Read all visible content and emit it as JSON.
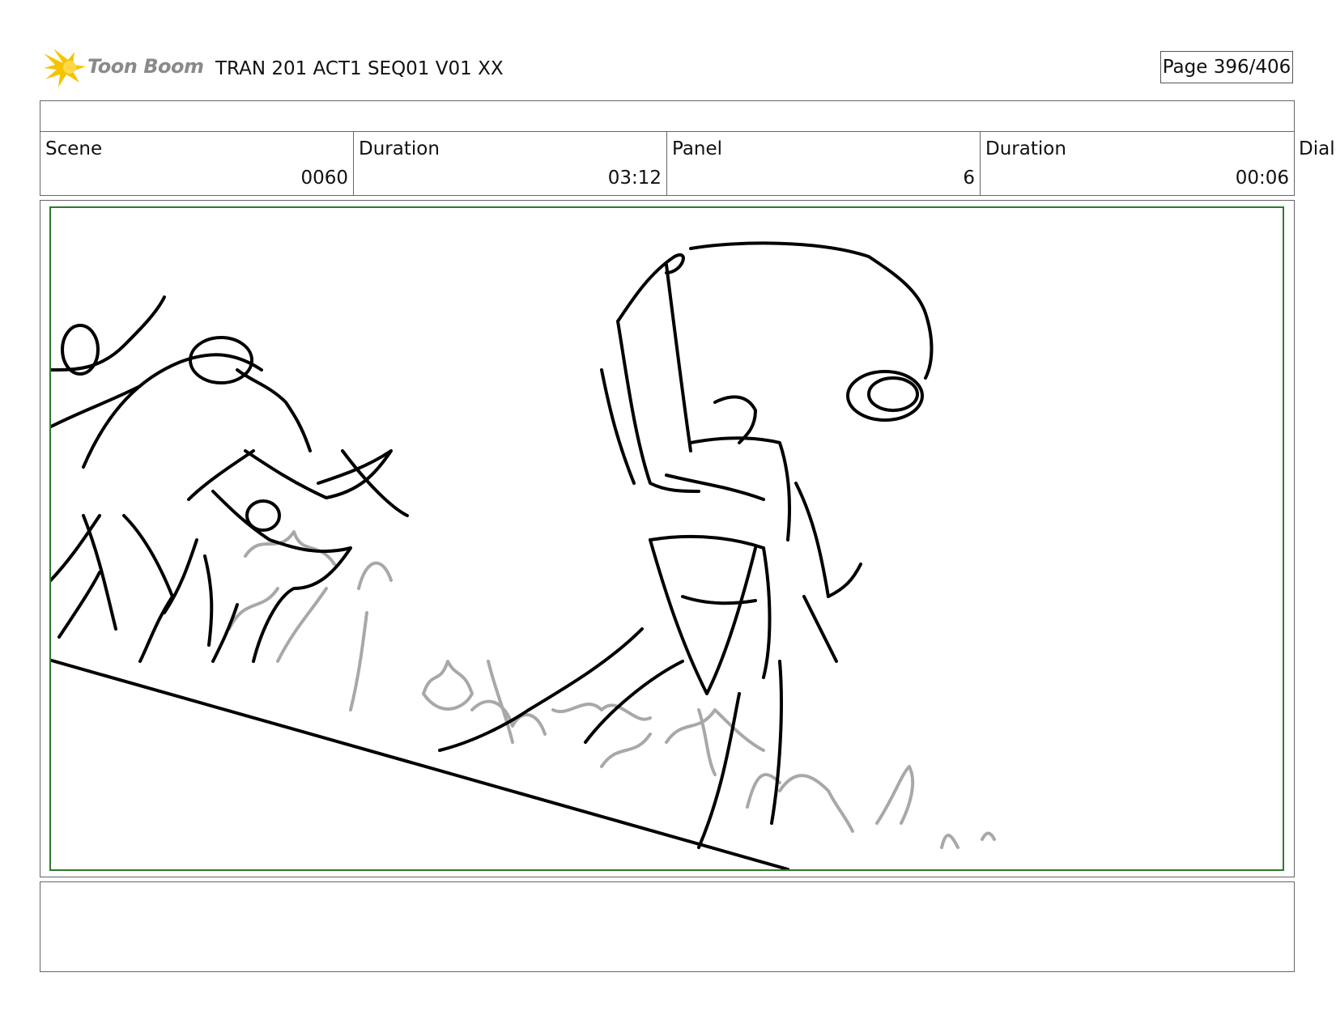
{
  "header": {
    "logo_text": "Toon Boom",
    "logo_icon": "starburst-icon",
    "title": "TRAN 201 ACT1 SEQ01 V01 XX",
    "page": "Page 396/406"
  },
  "info_row": {
    "scene_label": "Scene",
    "scene_value": "0060",
    "scene_duration_label": "Duration",
    "scene_duration_value": "03:12",
    "panel_label": "Panel",
    "panel_value": "6",
    "panel_duration_label": "Duration",
    "panel_duration_value": "00:06",
    "dialog_label": "Dialo"
  },
  "colors": {
    "panel_border": "#2d7a2d",
    "logo_star": "#f5c400",
    "sketch_line": "#000000",
    "sketch_light": "#a8a8a8"
  }
}
